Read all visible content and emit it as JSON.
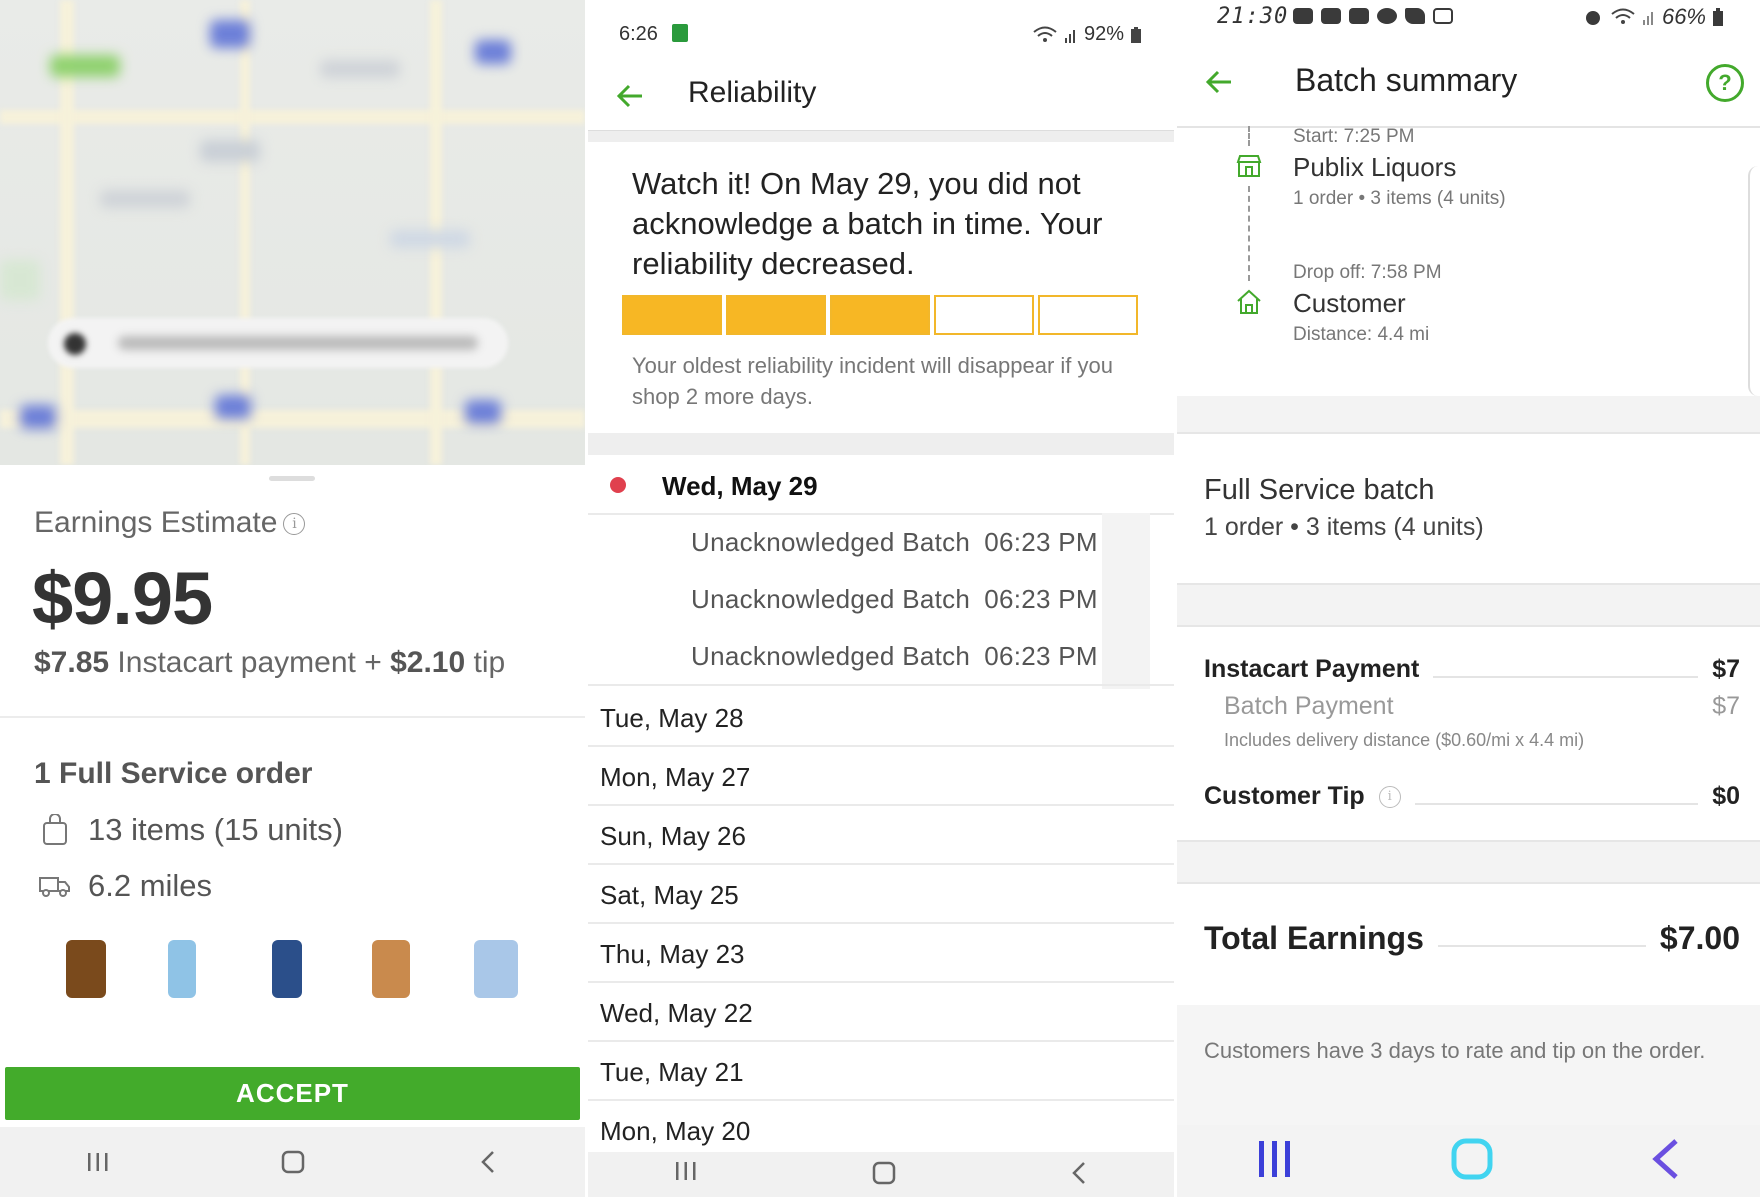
{
  "panel1": {
    "earnings_label": "Earnings Estimate",
    "info_glyph": "i",
    "earnings_amount": "$9.95",
    "instacart_amount": "$7.85",
    "instacart_text": "Instacart payment +",
    "tip_amount": "$2.10",
    "tip_text": "tip",
    "order_title": "1 Full Service order",
    "items_text": "13 items (15 units)",
    "distance_text": "6.2 miles",
    "accept_label": "ACCEPT",
    "product_colors": [
      "#7a4a1c",
      "#8fc3e6",
      "#2b4f8a",
      "#c98a4d",
      "#a9c7e8"
    ]
  },
  "panel2": {
    "time": "6:26",
    "battery": "92%",
    "title": "Reliability",
    "warning": "Watch it! On May 29, you did not acknowledge a batch in time. Your reliability decreased.",
    "bars_filled": 3,
    "bars_total": 5,
    "bar_color": "#f7b724",
    "subtext": "Your oldest reliability incident will disappear if you shop 2 more days.",
    "current_day": "Wed, May 29",
    "incidents": [
      {
        "label": "Unacknowledged Batch",
        "time": "06:23 PM"
      },
      {
        "label": "Unacknowledged Batch",
        "time": "06:23 PM"
      },
      {
        "label": "Unacknowledged Batch",
        "time": "06:23 PM"
      }
    ],
    "days": [
      "Tue, May 28",
      "Mon, May 27",
      "Sun, May 26",
      "Sat, May 25",
      "Thu, May 23",
      "Wed, May 22",
      "Tue, May 21",
      "Mon, May 20"
    ]
  },
  "panel3": {
    "time": "21:30",
    "battery": "66%",
    "title": "Batch summary",
    "help_glyph": "?",
    "start_label": "Start: 7:25 PM",
    "store_name": "Publix Liquors",
    "store_sub": "1 order • 3 items (4 units)",
    "drop_label": "Drop off: 7:58 PM",
    "customer_name": "Customer",
    "customer_distance": "Distance: 4.4 mi",
    "batch_type": "Full Service batch",
    "batch_sub": "1 order • 3 items (4 units)",
    "instacart_payment_label": "Instacart Payment",
    "instacart_payment_value": "$7",
    "batch_payment_label": "Batch Payment",
    "batch_payment_value": "$7",
    "distance_note": "Includes delivery distance ($0.60/mi x 4.4 mi)",
    "customer_tip_label": "Customer Tip",
    "customer_tip_value": "$0",
    "total_label": "Total Earnings",
    "total_value": "$7.00",
    "footer_text": "Customers have 3 days to rate and tip on the order.",
    "accent_color": "#43a92c"
  }
}
